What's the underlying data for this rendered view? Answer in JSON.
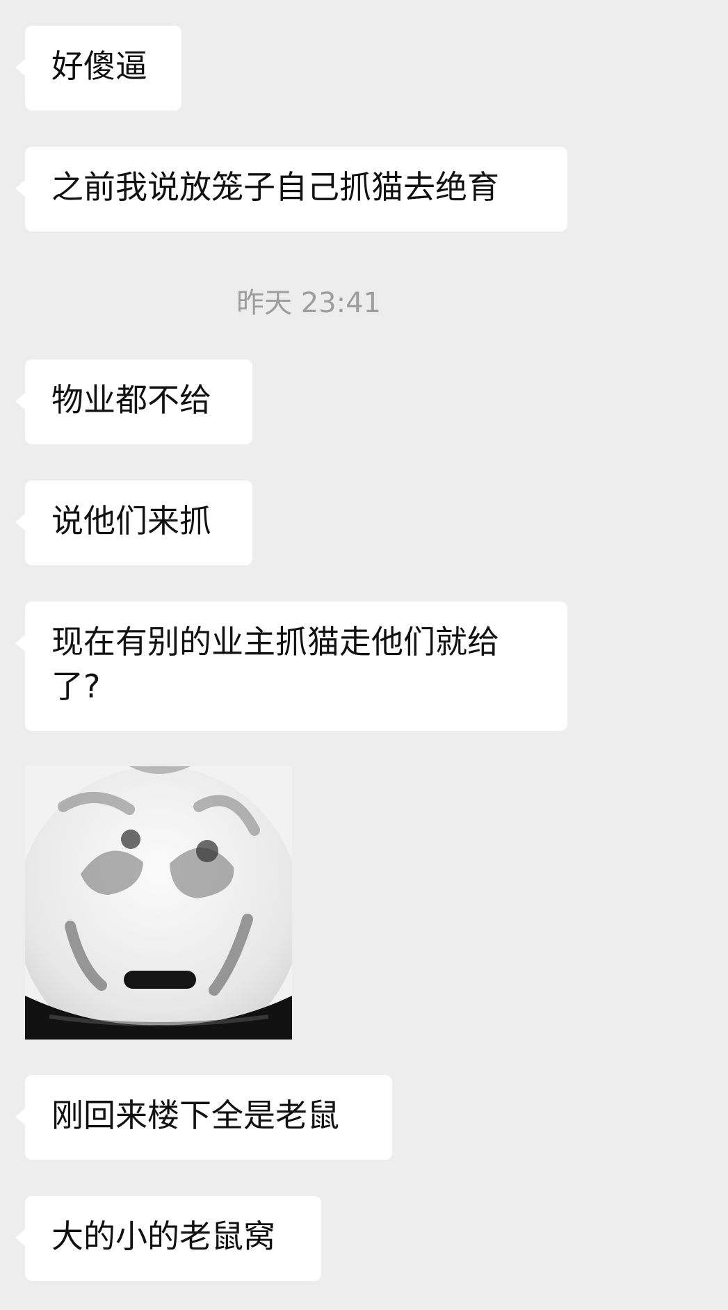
{
  "chat": {
    "messages": [
      {
        "type": "text",
        "text": "好傻逼"
      },
      {
        "type": "text",
        "text": "之前我说放笼子自己抓猫去绝育"
      },
      {
        "type": "timestamp",
        "text": "昨天 23:41"
      },
      {
        "type": "text",
        "text": "物业都不给"
      },
      {
        "type": "text",
        "text": "说他们来抓"
      },
      {
        "type": "text",
        "text": "现在有别的业主抓猫走他们就给\n了?"
      },
      {
        "type": "sticker",
        "icon": "meme-face-icon"
      },
      {
        "type": "text",
        "text": "刚回来楼下全是老鼠"
      },
      {
        "type": "text",
        "text": "大的小的老鼠窝"
      }
    ]
  }
}
